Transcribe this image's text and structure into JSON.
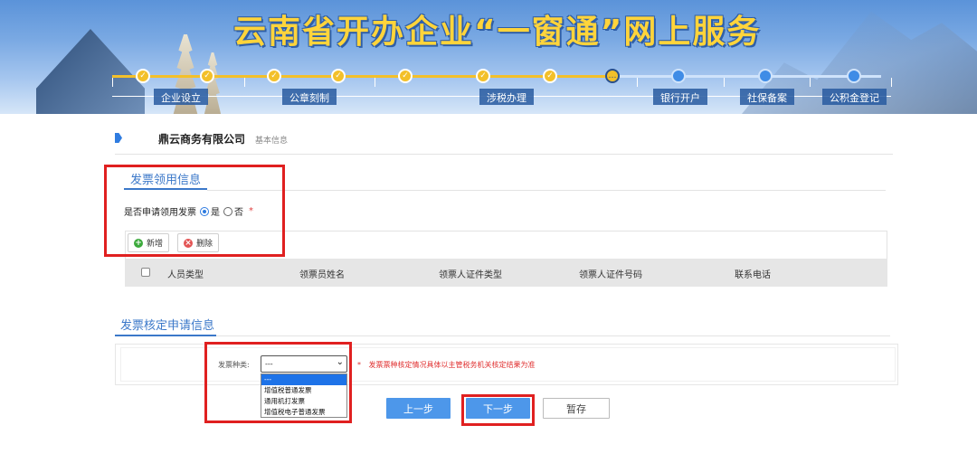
{
  "banner": {
    "title": "云南省开办企业“一窗通”网上服务",
    "stages": [
      "企业设立",
      "公章刻制",
      "涉税办理",
      "银行开户",
      "社保备案",
      "公积金登记"
    ]
  },
  "company": {
    "name": "鼎云商务有限公司",
    "subtab": "基本信息"
  },
  "invoice_apply": {
    "section_title": "发票领用信息",
    "question": "是否申请领用发票",
    "options": [
      {
        "label": "是",
        "checked": true
      },
      {
        "label": "否",
        "checked": false
      }
    ],
    "required_mark": "*",
    "add_label": "新增",
    "delete_label": "删除",
    "columns": [
      "人员类型",
      "领票员姓名",
      "领票人证件类型",
      "领票人证件号码",
      "联系电话"
    ]
  },
  "invoice_check": {
    "section_title": "发票核定申请信息",
    "field_label": "发票种类:",
    "selected": "---",
    "dropdown_options": [
      "---",
      "增值税普通发票",
      "通用机打发票",
      "增值税电子普通发票"
    ],
    "required_mark": "*",
    "note": "发票票种核定情况具体以主管税务机关核定结果为准"
  },
  "buttons": {
    "prev": "上一步",
    "next": "下一步",
    "save": "暂存"
  },
  "colors": {
    "accent": "#3b78c9",
    "primary_button": "#4d97ea",
    "highlight_box": "#e02020",
    "banner_title": "#ffd43b"
  }
}
